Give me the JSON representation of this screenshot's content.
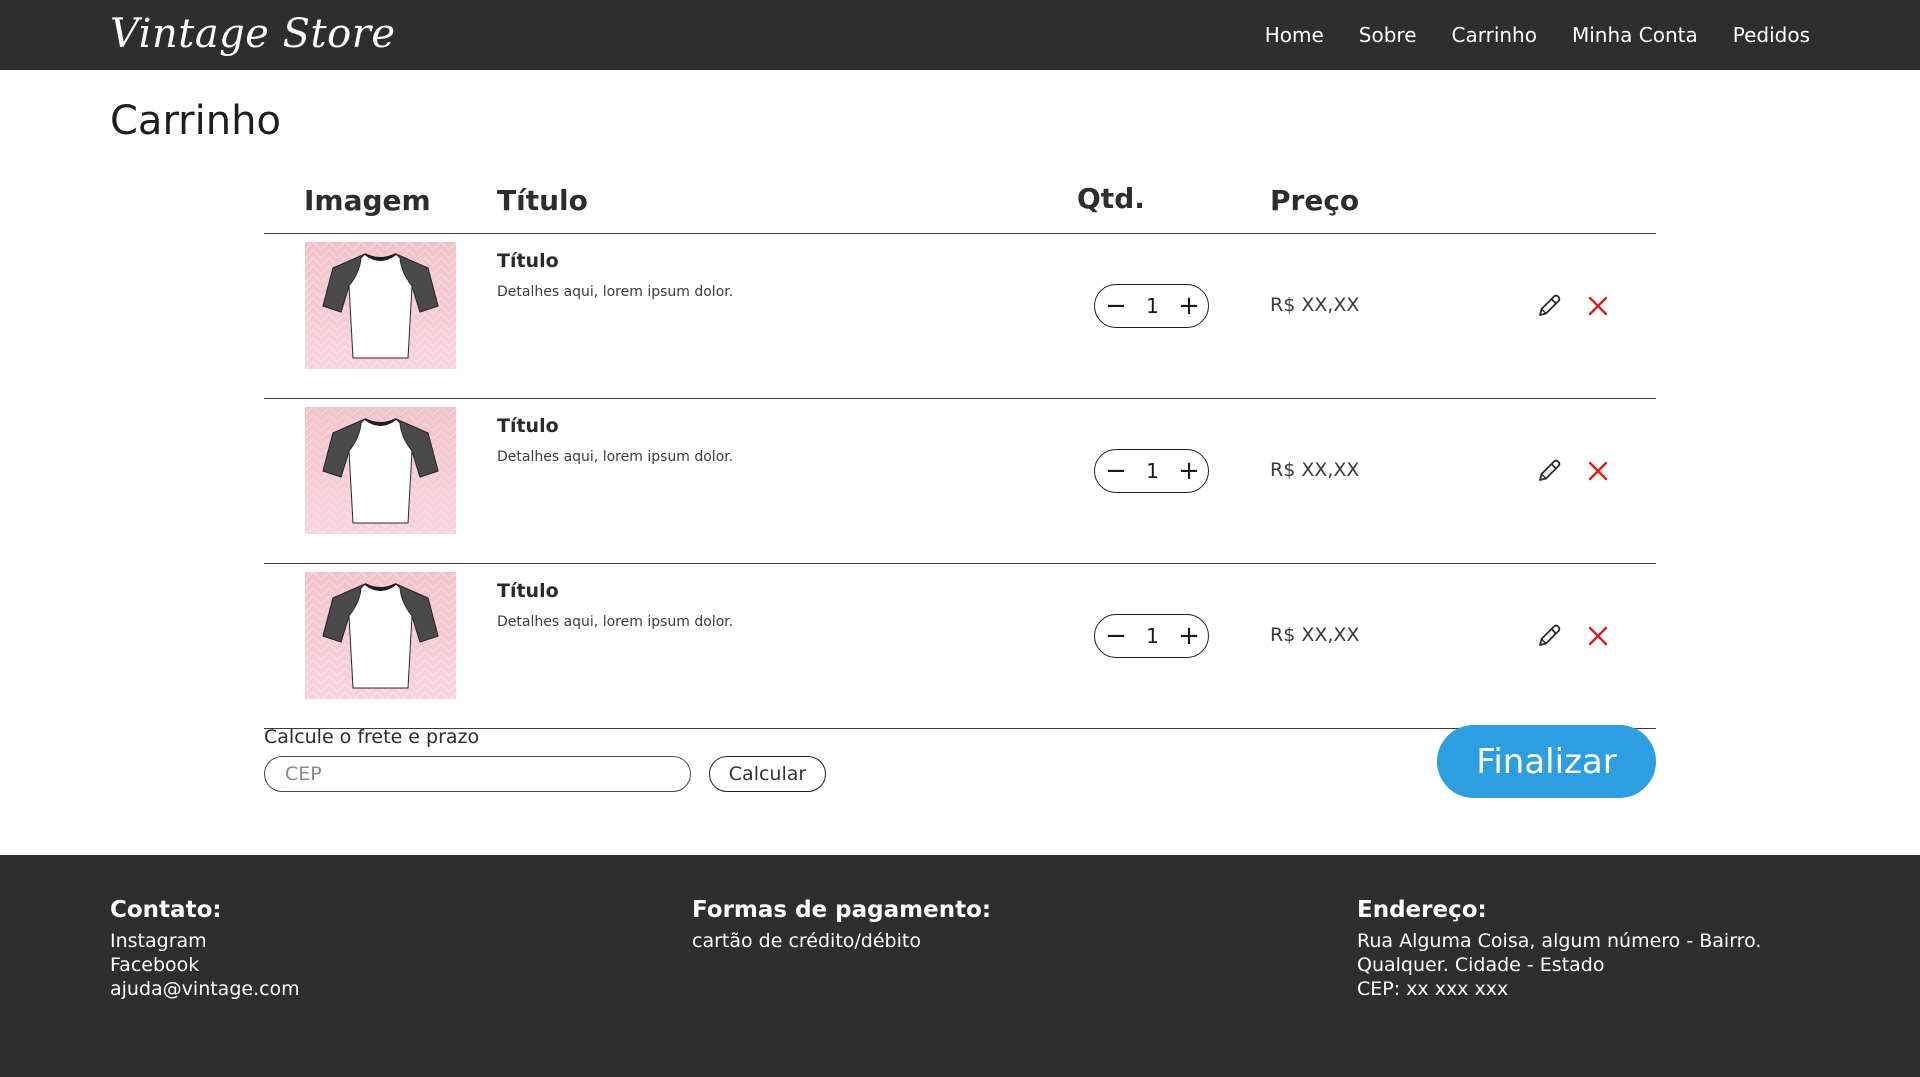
{
  "header": {
    "logo": "Vintage Store",
    "nav": [
      "Home",
      "Sobre",
      "Carrinho",
      "Minha Conta",
      "Pedidos"
    ]
  },
  "page_title": "Carrinho",
  "table": {
    "columns": {
      "image": "Imagem",
      "title": "Título",
      "qty": "Qtd.",
      "price": "Preço"
    },
    "rows": [
      {
        "title": "Título",
        "desc": "Detalhes aqui, lorem ipsum dolor.",
        "qty": "1",
        "price": "R$ XX,XX"
      },
      {
        "title": "Título",
        "desc": "Detalhes aqui, lorem ipsum dolor.",
        "qty": "1",
        "price": "R$ XX,XX"
      },
      {
        "title": "Título",
        "desc": "Detalhes aqui, lorem ipsum dolor.",
        "qty": "1",
        "price": "R$ XX,XX"
      }
    ],
    "minus": "−",
    "plus": "+"
  },
  "shipping": {
    "label": "Calcule o frete e prazo",
    "placeholder": "CEP",
    "calc_label": "Calcular"
  },
  "finalize_label": "Finalizar",
  "footer": {
    "contact": {
      "heading": "Contato:",
      "lines": [
        "Instagram",
        "Facebook",
        "ajuda@vintage.com"
      ]
    },
    "payment": {
      "heading": "Formas de pagamento:",
      "lines": [
        "cartão de crédito/débito"
      ]
    },
    "address": {
      "heading": "Endereço:",
      "lines": [
        "Rua Alguma Coisa, algum número - Bairro.",
        "Qualquer. Cidade - Estado",
        "CEP: xx xxx xxx"
      ]
    }
  },
  "colors": {
    "header_bg": "#2e2e2e",
    "accent": "#2f9ee0",
    "delete": "#d42020"
  }
}
